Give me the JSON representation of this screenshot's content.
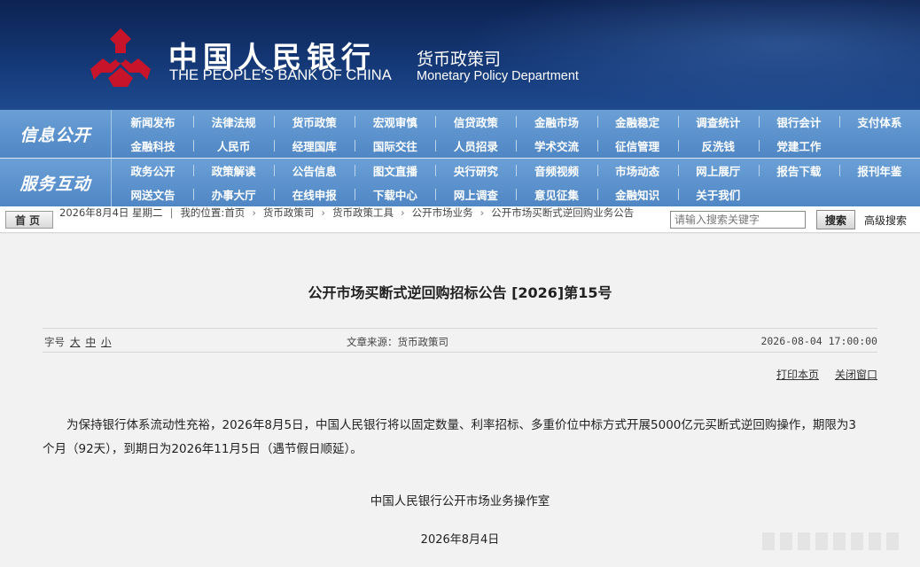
{
  "banner": {
    "cn_name": "中国人民银行",
    "en_name": "THE PEOPLE'S BANK OF CHINA",
    "dept_cn": "货币政策司",
    "dept_en": "Monetary Policy Department",
    "logo_icon": "pboc-emblem-icon",
    "logo_color": "#c8142a"
  },
  "nav": {
    "info": {
      "label": "信息公开",
      "items": [
        "新闻发布",
        "法律法规",
        "货币政策",
        "宏观审慎",
        "信贷政策",
        "金融市场",
        "金融稳定",
        "调查统计",
        "银行会计",
        "支付体系",
        "金融科技",
        "人民币",
        "经理国库",
        "国际交往",
        "人员招录",
        "学术交流",
        "征信管理",
        "反洗钱",
        "党建工作"
      ]
    },
    "service": {
      "label": "服务互动",
      "items": [
        "政务公开",
        "政策解读",
        "公告信息",
        "图文直播",
        "央行研究",
        "音频视频",
        "市场动态",
        "网上展厅",
        "报告下载",
        "报刊年鉴",
        "网送文告",
        "办事大厅",
        "在线申报",
        "下载中心",
        "网上调查",
        "意见征集",
        "金融知识",
        "关于我们"
      ]
    }
  },
  "crumb": {
    "home": "首页",
    "date": "2026年8月4日 星期二",
    "location_label": "我的位置:",
    "path": [
      "首页",
      "货币政策司",
      "货币政策工具",
      "公开市场业务",
      "公开市场买断式逆回购业务公告"
    ],
    "search_placeholder": "请输入搜索关键字",
    "search_button": "搜索",
    "advanced_search": "高级搜索"
  },
  "article": {
    "title": "公开市场买断式逆回购招标公告 [2026]第15号",
    "font_size_label": "字号",
    "font_sizes": [
      "大",
      "中",
      "小"
    ],
    "source": "文章来源：货币政策司",
    "datetime": "2026-08-04  17:00:00",
    "print": "打印本页",
    "close": "关闭窗口",
    "body": "为保持银行体系流动性充裕，2026年8月5日，中国人民银行将以固定数量、利率招标、多重价位中标方式开展5000亿元买断式逆回购操作，期限为3个月（92天），到期日为2026年11月5日（遇节假日顺延）。",
    "signature": "中国人民银行公开市场业务操作室",
    "sign_date": "2026年8月4日"
  }
}
